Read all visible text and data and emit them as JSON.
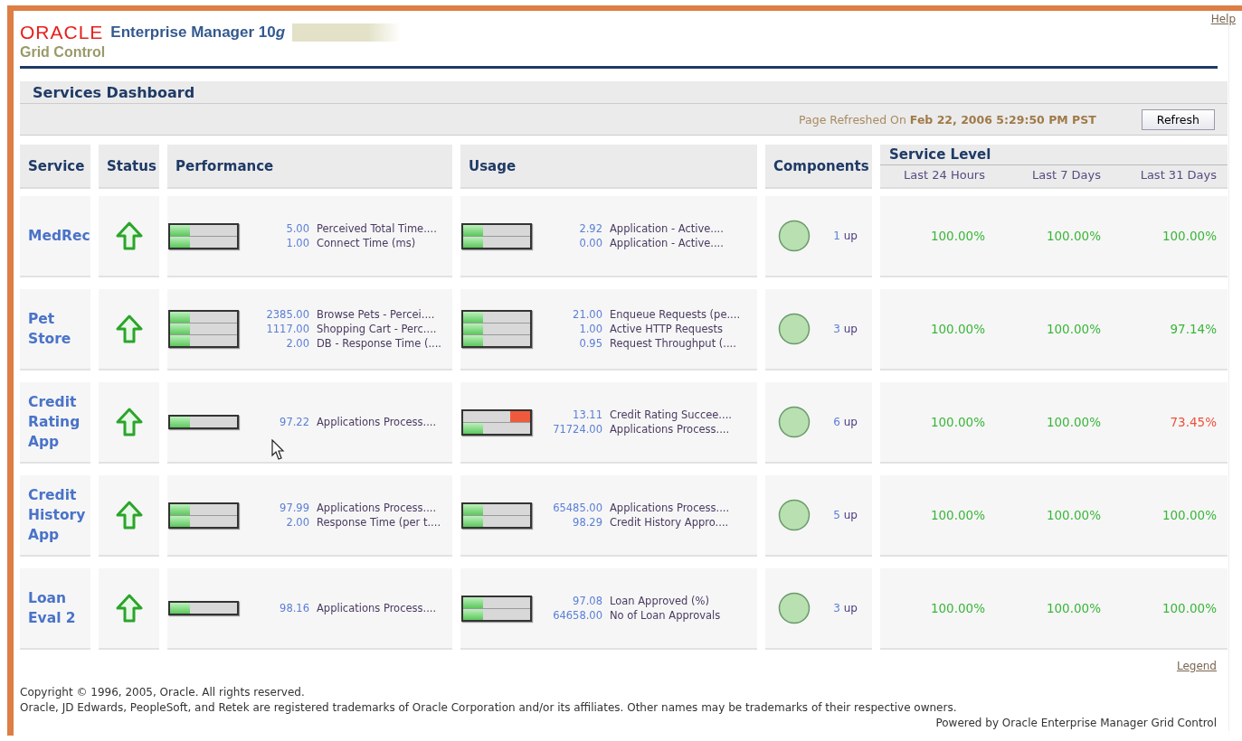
{
  "header": {
    "brand": "ORACLE",
    "product": "Enterprise Manager 10",
    "product_suffix": "g",
    "subtitle": "Grid Control",
    "help_link": "Help"
  },
  "page": {
    "title": "Services Dashboard",
    "refreshed_label": "Page Refreshed On",
    "refreshed_at": "Feb 22, 2006 5:29:50 PM PST",
    "refresh_button": "Refresh"
  },
  "table": {
    "columns": [
      "Service",
      "Status",
      "Performance",
      "Usage",
      "Components"
    ],
    "service_level": {
      "title": "Service Level",
      "periods": [
        "Last 24 Hours",
        "Last 7 Days",
        "Last 31 Days"
      ]
    },
    "rows": [
      {
        "service": "MedRec",
        "status_up": true,
        "performance": [
          {
            "reading": "5.00",
            "metric": "Perceived Total Time....",
            "level": 0.3,
            "alert": false
          },
          {
            "reading": "1.00",
            "metric": "Connect Time (ms)",
            "level": 0.3,
            "alert": false
          }
        ],
        "usage": [
          {
            "reading": "2.92",
            "metric": "Application - Active....",
            "level": 0.3,
            "alert": false
          },
          {
            "reading": "0.00",
            "metric": "Application - Active....",
            "level": 0.3,
            "alert": false
          }
        ],
        "components_count": "1",
        "components_status": "up",
        "service_level": [
          {
            "value": "100.00%",
            "met": true
          },
          {
            "value": "100.00%",
            "met": true
          },
          {
            "value": "100.00%",
            "met": true
          }
        ]
      },
      {
        "service": "Pet Store",
        "status_up": true,
        "performance": [
          {
            "reading": "2385.00",
            "metric": "Browse Pets - Percei....",
            "level": 0.3,
            "alert": false
          },
          {
            "reading": "1117.00",
            "metric": "Shopping Cart - Perc....",
            "level": 0.3,
            "alert": false
          },
          {
            "reading": "2.00",
            "metric": "DB - Response Time (....",
            "level": 0.3,
            "alert": false
          }
        ],
        "usage": [
          {
            "reading": "21.00",
            "metric": "Enqueue Requests (pe....",
            "level": 0.3,
            "alert": false
          },
          {
            "reading": "1.00",
            "metric": "Active HTTP Requests",
            "level": 0.3,
            "alert": false
          },
          {
            "reading": "0.95",
            "metric": "Request Throughput (....",
            "level": 0.3,
            "alert": false
          }
        ],
        "components_count": "3",
        "components_status": "up",
        "service_level": [
          {
            "value": "100.00%",
            "met": true
          },
          {
            "value": "100.00%",
            "met": true
          },
          {
            "value": "97.14%",
            "met": true
          }
        ]
      },
      {
        "service": "Credit Rating App",
        "status_up": true,
        "performance": [
          {
            "reading": "97.22",
            "metric": "Applications Process....",
            "level": 0.3,
            "alert": false
          }
        ],
        "usage": [
          {
            "reading": "13.11",
            "metric": "Credit Rating Succee....",
            "level": 0.3,
            "alert": true
          },
          {
            "reading": "71724.00",
            "metric": "Applications Process....",
            "level": 0.3,
            "alert": false
          }
        ],
        "components_count": "6",
        "components_status": "up",
        "service_level": [
          {
            "value": "100.00%",
            "met": true
          },
          {
            "value": "100.00%",
            "met": true
          },
          {
            "value": "73.45%",
            "met": false
          }
        ]
      },
      {
        "service": "Credit History App",
        "status_up": true,
        "performance": [
          {
            "reading": "97.99",
            "metric": "Applications Process....",
            "level": 0.3,
            "alert": false
          },
          {
            "reading": "2.00",
            "metric": "Response Time (per t....",
            "level": 0.3,
            "alert": false
          }
        ],
        "usage": [
          {
            "reading": "65485.00",
            "metric": "Applications Process....",
            "level": 0.3,
            "alert": false
          },
          {
            "reading": "98.29",
            "metric": "Credit History Appro....",
            "level": 0.3,
            "alert": false
          }
        ],
        "components_count": "5",
        "components_status": "up",
        "service_level": [
          {
            "value": "100.00%",
            "met": true
          },
          {
            "value": "100.00%",
            "met": true
          },
          {
            "value": "100.00%",
            "met": true
          }
        ]
      },
      {
        "service": "Loan Eval 2",
        "status_up": true,
        "performance": [
          {
            "reading": "98.16",
            "metric": "Applications Process....",
            "level": 0.3,
            "alert": false
          }
        ],
        "usage": [
          {
            "reading": "97.08",
            "metric": "Loan Approved (%)",
            "level": 0.3,
            "alert": false
          },
          {
            "reading": "64658.00",
            "metric": "No of Loan Approvals",
            "level": 0.3,
            "alert": false
          }
        ],
        "components_count": "3",
        "components_status": "up",
        "service_level": [
          {
            "value": "100.00%",
            "met": true
          },
          {
            "value": "100.00%",
            "met": true
          },
          {
            "value": "100.00%",
            "met": true
          }
        ]
      }
    ]
  },
  "footer": {
    "legend_link": "Legend",
    "copyright": "Copyright © 1996, 2005, Oracle. All rights reserved.",
    "trademarks": "Oracle, JD Edwards, PeopleSoft, and Retek are registered trademarks of Oracle Corporation and/or its affiliates. Other names may be trademarks of their respective owners.",
    "powered_by": "Powered by Oracle Enterprise Manager Grid Control"
  }
}
